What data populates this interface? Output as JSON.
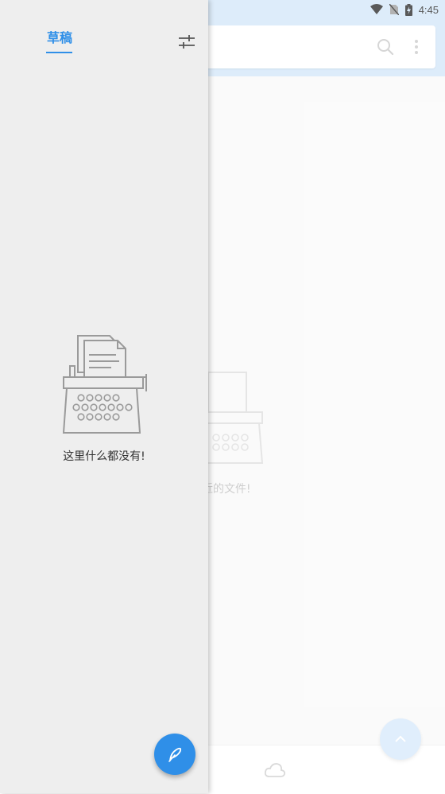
{
  "status_bar": {
    "time": "4:45",
    "icons": [
      "wifi-icon",
      "no-sim-icon",
      "battery-charging-icon"
    ]
  },
  "main": {
    "empty_text_visible": "最近的文件!",
    "search_icon": "search-icon",
    "menu_icon": "more-vert-icon"
  },
  "bottom_nav": {
    "tabs": [
      "cloud-icon"
    ]
  },
  "drawer": {
    "tab_label": "草稿",
    "filter_icon": "tune-icon",
    "empty_text": "这里什么都没有!",
    "fab_icon": "feather-pen-icon"
  },
  "colors": {
    "accent": "#2f8fe8",
    "topbar": "#d2e6f9",
    "drawer_bg": "#eeeeee"
  }
}
